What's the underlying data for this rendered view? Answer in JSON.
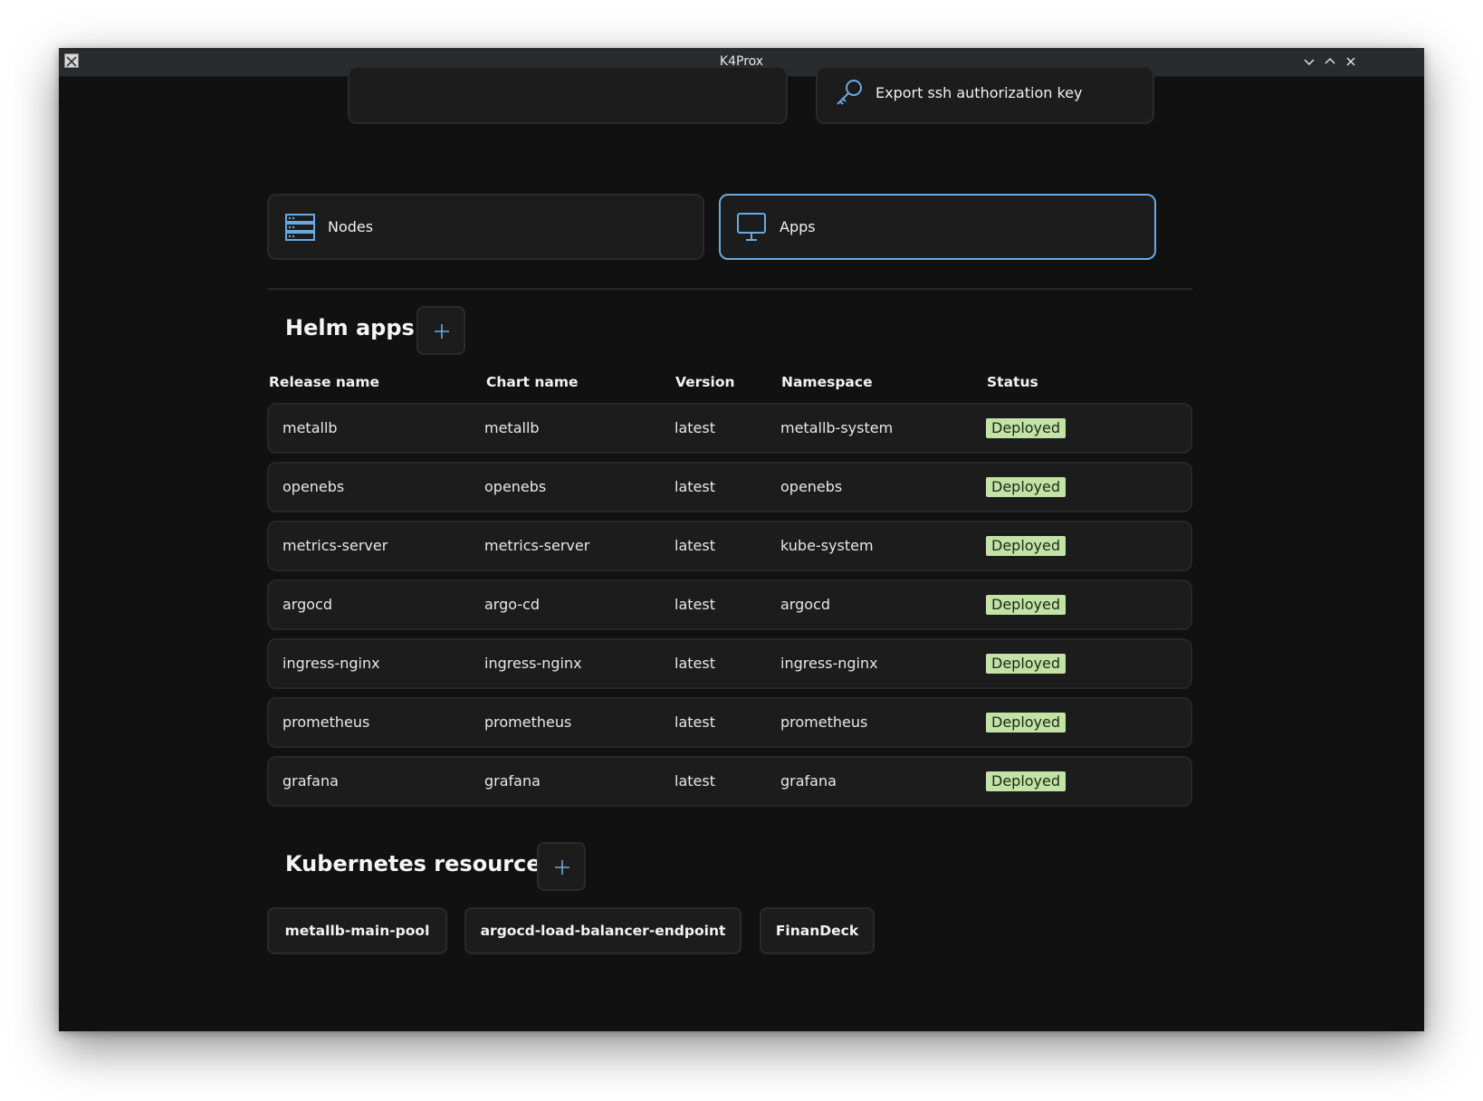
{
  "window": {
    "title": "K4Prox"
  },
  "actions": {
    "export_key": "Export ssh authorization key"
  },
  "nav": {
    "nodes": "Nodes",
    "apps": "Apps"
  },
  "helm": {
    "title": "Helm apps",
    "columns": [
      "Release name",
      "Chart name",
      "Version",
      "Namespace",
      "Status"
    ],
    "rows": [
      {
        "release": "metallb",
        "chart": "metallb",
        "version": "latest",
        "namespace": "metallb-system",
        "status": "Deployed"
      },
      {
        "release": "openebs",
        "chart": "openebs",
        "version": "latest",
        "namespace": "openebs",
        "status": "Deployed"
      },
      {
        "release": "metrics-server",
        "chart": "metrics-server",
        "version": "latest",
        "namespace": "kube-system",
        "status": "Deployed"
      },
      {
        "release": "argocd",
        "chart": "argo-cd",
        "version": "latest",
        "namespace": "argocd",
        "status": "Deployed"
      },
      {
        "release": "ingress-nginx",
        "chart": "ingress-nginx",
        "version": "latest",
        "namespace": "ingress-nginx",
        "status": "Deployed"
      },
      {
        "release": "prometheus",
        "chart": "prometheus",
        "version": "latest",
        "namespace": "prometheus",
        "status": "Deployed"
      },
      {
        "release": "grafana",
        "chart": "grafana",
        "version": "latest",
        "namespace": "grafana",
        "status": "Deployed"
      }
    ]
  },
  "k8s": {
    "title": "Kubernetes resources",
    "resources": [
      "metallb-main-pool",
      "argocd-load-balancer-endpoint",
      "FinanDeck"
    ]
  },
  "colors": {
    "accent": "#6aa9df",
    "badge_bg": "#c2e2a6",
    "background": "#111111",
    "card": "#1c1c1c"
  }
}
